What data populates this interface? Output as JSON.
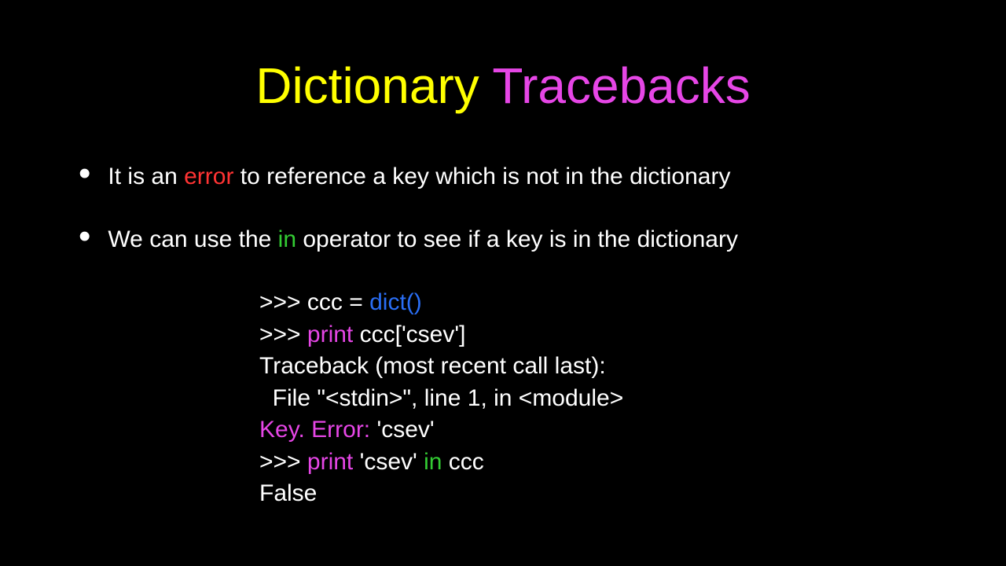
{
  "title": {
    "word1": "Dictionary",
    "word2": "Tracebacks"
  },
  "bullets": [
    {
      "pre": "It is an ",
      "kw": "error",
      "post": " to reference a key which is not in the dictionary",
      "kwClass": "kw-error"
    },
    {
      "pre": "We can use the ",
      "kw": "in",
      "post": " operator to see if a key is in the dictionary",
      "kwClass": "kw-in"
    }
  ],
  "code": {
    "l1a": ">>> ccc = ",
    "l1b": "dict()",
    "l2a": ">>> ",
    "l2b": "print ",
    "l2c": "ccc['csev']",
    "l3": "Traceback (most recent call last):",
    "l4": "  File \"<stdin>\", line 1, in <module>",
    "l5a": "Key. Error: ",
    "l5b": "'csev'",
    "l6a": ">>> ",
    "l6b": "print ",
    "l6c": "'csev' ",
    "l6d": "in ",
    "l6e": "ccc",
    "l7": "False"
  }
}
